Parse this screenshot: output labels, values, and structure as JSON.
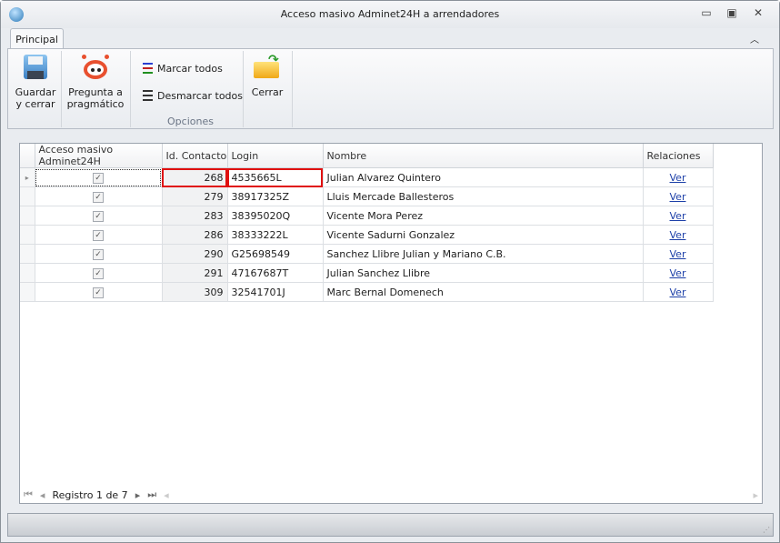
{
  "window": {
    "title": "Acceso masivo Adminet24H a arrendadores"
  },
  "tabs": [
    {
      "label": "Principal"
    }
  ],
  "ribbon": {
    "save": "Guardar\ny cerrar",
    "ask": "Pregunta a\npragmático",
    "check_all": "Marcar todos",
    "uncheck_all": "Desmarcar todos",
    "group_label": "Opciones",
    "close": "Cerrar"
  },
  "grid": {
    "columns": [
      "Acceso masivo Adminet24H",
      "Id. Contacto",
      "Login",
      "Nombre",
      "Relaciones"
    ],
    "rows": [
      {
        "checked": true,
        "id": "268",
        "login": "4535665L",
        "name": "Julian Alvarez Quintero",
        "rel": "Ver"
      },
      {
        "checked": true,
        "id": "279",
        "login": "38917325Z",
        "name": "Lluis Mercade Ballesteros",
        "rel": "Ver"
      },
      {
        "checked": true,
        "id": "283",
        "login": "38395020Q",
        "name": "Vicente Mora Perez",
        "rel": "Ver"
      },
      {
        "checked": true,
        "id": "286",
        "login": "38333222L",
        "name": "Vicente Sadurni Gonzalez",
        "rel": "Ver"
      },
      {
        "checked": true,
        "id": "290",
        "login": "G25698549",
        "name": "Sanchez Llibre Julian y Mariano C.B.",
        "rel": "Ver"
      },
      {
        "checked": true,
        "id": "291",
        "login": "47167687T",
        "name": "Julian Sanchez Llibre",
        "rel": "Ver"
      },
      {
        "checked": true,
        "id": "309",
        "login": "32541701J",
        "name": "Marc Bernal Domenech",
        "rel": "Ver"
      }
    ],
    "navigator": "Registro 1 de 7"
  }
}
